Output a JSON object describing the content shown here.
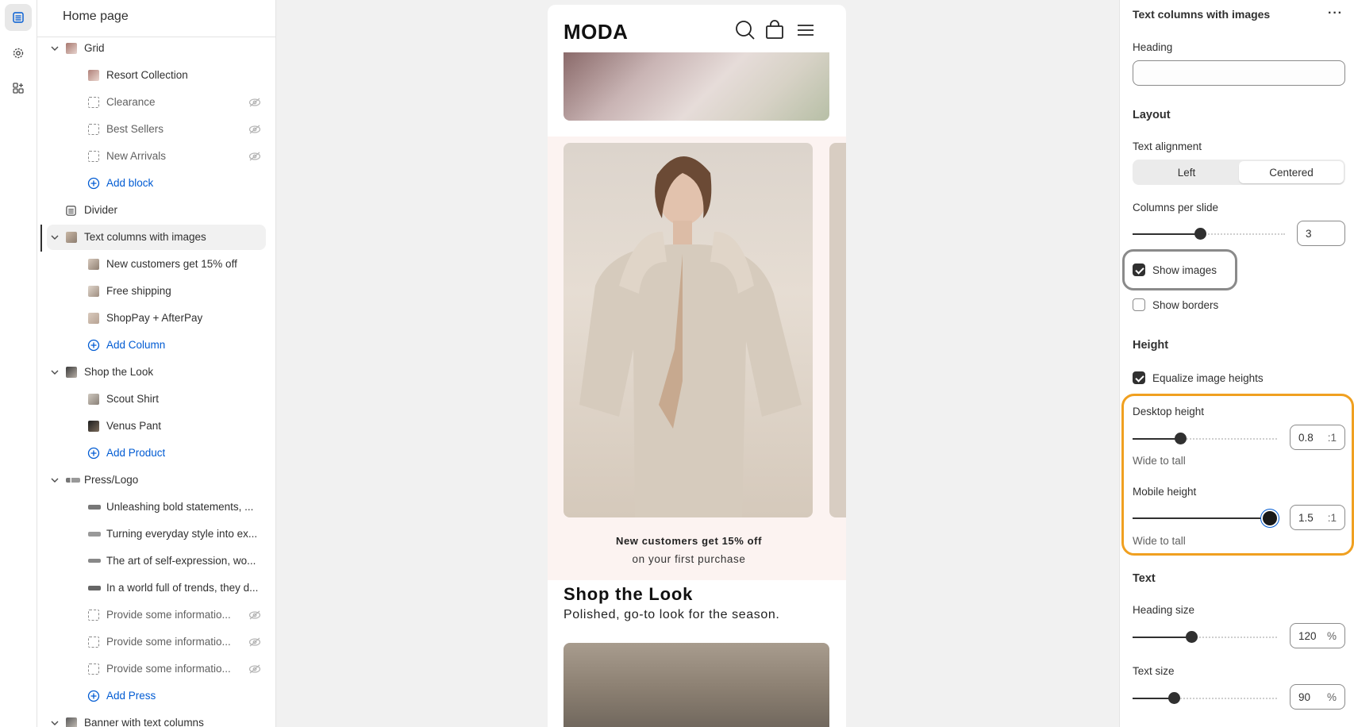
{
  "sidebar": {
    "title": "Home page",
    "items": [
      {
        "label": "Grid"
      },
      {
        "label": "Resort Collection"
      },
      {
        "label": "Clearance"
      },
      {
        "label": "Best Sellers"
      },
      {
        "label": "New Arrivals"
      },
      {
        "label": "Add block"
      },
      {
        "label": "Divider"
      },
      {
        "label": "Text columns with images"
      },
      {
        "label": "New customers get 15% off"
      },
      {
        "label": "Free shipping"
      },
      {
        "label": "ShopPay + AfterPay"
      },
      {
        "label": "Add Column"
      },
      {
        "label": "Shop the Look"
      },
      {
        "label": "Scout Shirt"
      },
      {
        "label": "Venus Pant"
      },
      {
        "label": "Add Product"
      },
      {
        "label": "Press/Logo"
      },
      {
        "label": "Unleashing bold statements, ..."
      },
      {
        "label": "Turning everyday style into ex..."
      },
      {
        "label": "The art of self-expression, wo..."
      },
      {
        "label": "In a world full of trends, they d..."
      },
      {
        "label": "Provide some informatio..."
      },
      {
        "label": "Provide some informatio..."
      },
      {
        "label": "Provide some informatio..."
      },
      {
        "label": "Add Press"
      },
      {
        "label": "Banner with text columns"
      }
    ]
  },
  "preview": {
    "logo": "MODA",
    "promo_heading": "New customers get 15% off",
    "promo_sub": "on your first purchase",
    "section_title": "Shop the Look",
    "section_sub": "Polished, go-to look for the season."
  },
  "panel": {
    "title": "Text columns with images",
    "more": "···",
    "heading_label": "Heading",
    "layout_section": "Layout",
    "text_alignment_label": "Text alignment",
    "align_left": "Left",
    "align_centered": "Centered",
    "columns_label": "Columns per slide",
    "columns_value": "3",
    "columns_fraction": 0.44,
    "show_images_label": "Show images",
    "show_borders_label": "Show borders",
    "height_section": "Height",
    "equalize_label": "Equalize image heights",
    "desktop_height_label": "Desktop height",
    "desktop_height_value": "0.8",
    "desktop_height_unit": ":1",
    "desktop_height_fraction": 0.32,
    "desktop_help": "Wide to tall",
    "mobile_height_label": "Mobile height",
    "mobile_height_value": "1.5",
    "mobile_height_unit": ":1",
    "mobile_height_fraction": 1.0,
    "mobile_help": "Wide to tall",
    "text_section": "Text",
    "heading_size_label": "Heading size",
    "heading_size_value": "120",
    "heading_size_unit": "%",
    "heading_size_fraction": 0.4,
    "text_size_label": "Text size",
    "text_size_value": "90",
    "text_size_unit": "%",
    "text_size_fraction": 0.27
  }
}
